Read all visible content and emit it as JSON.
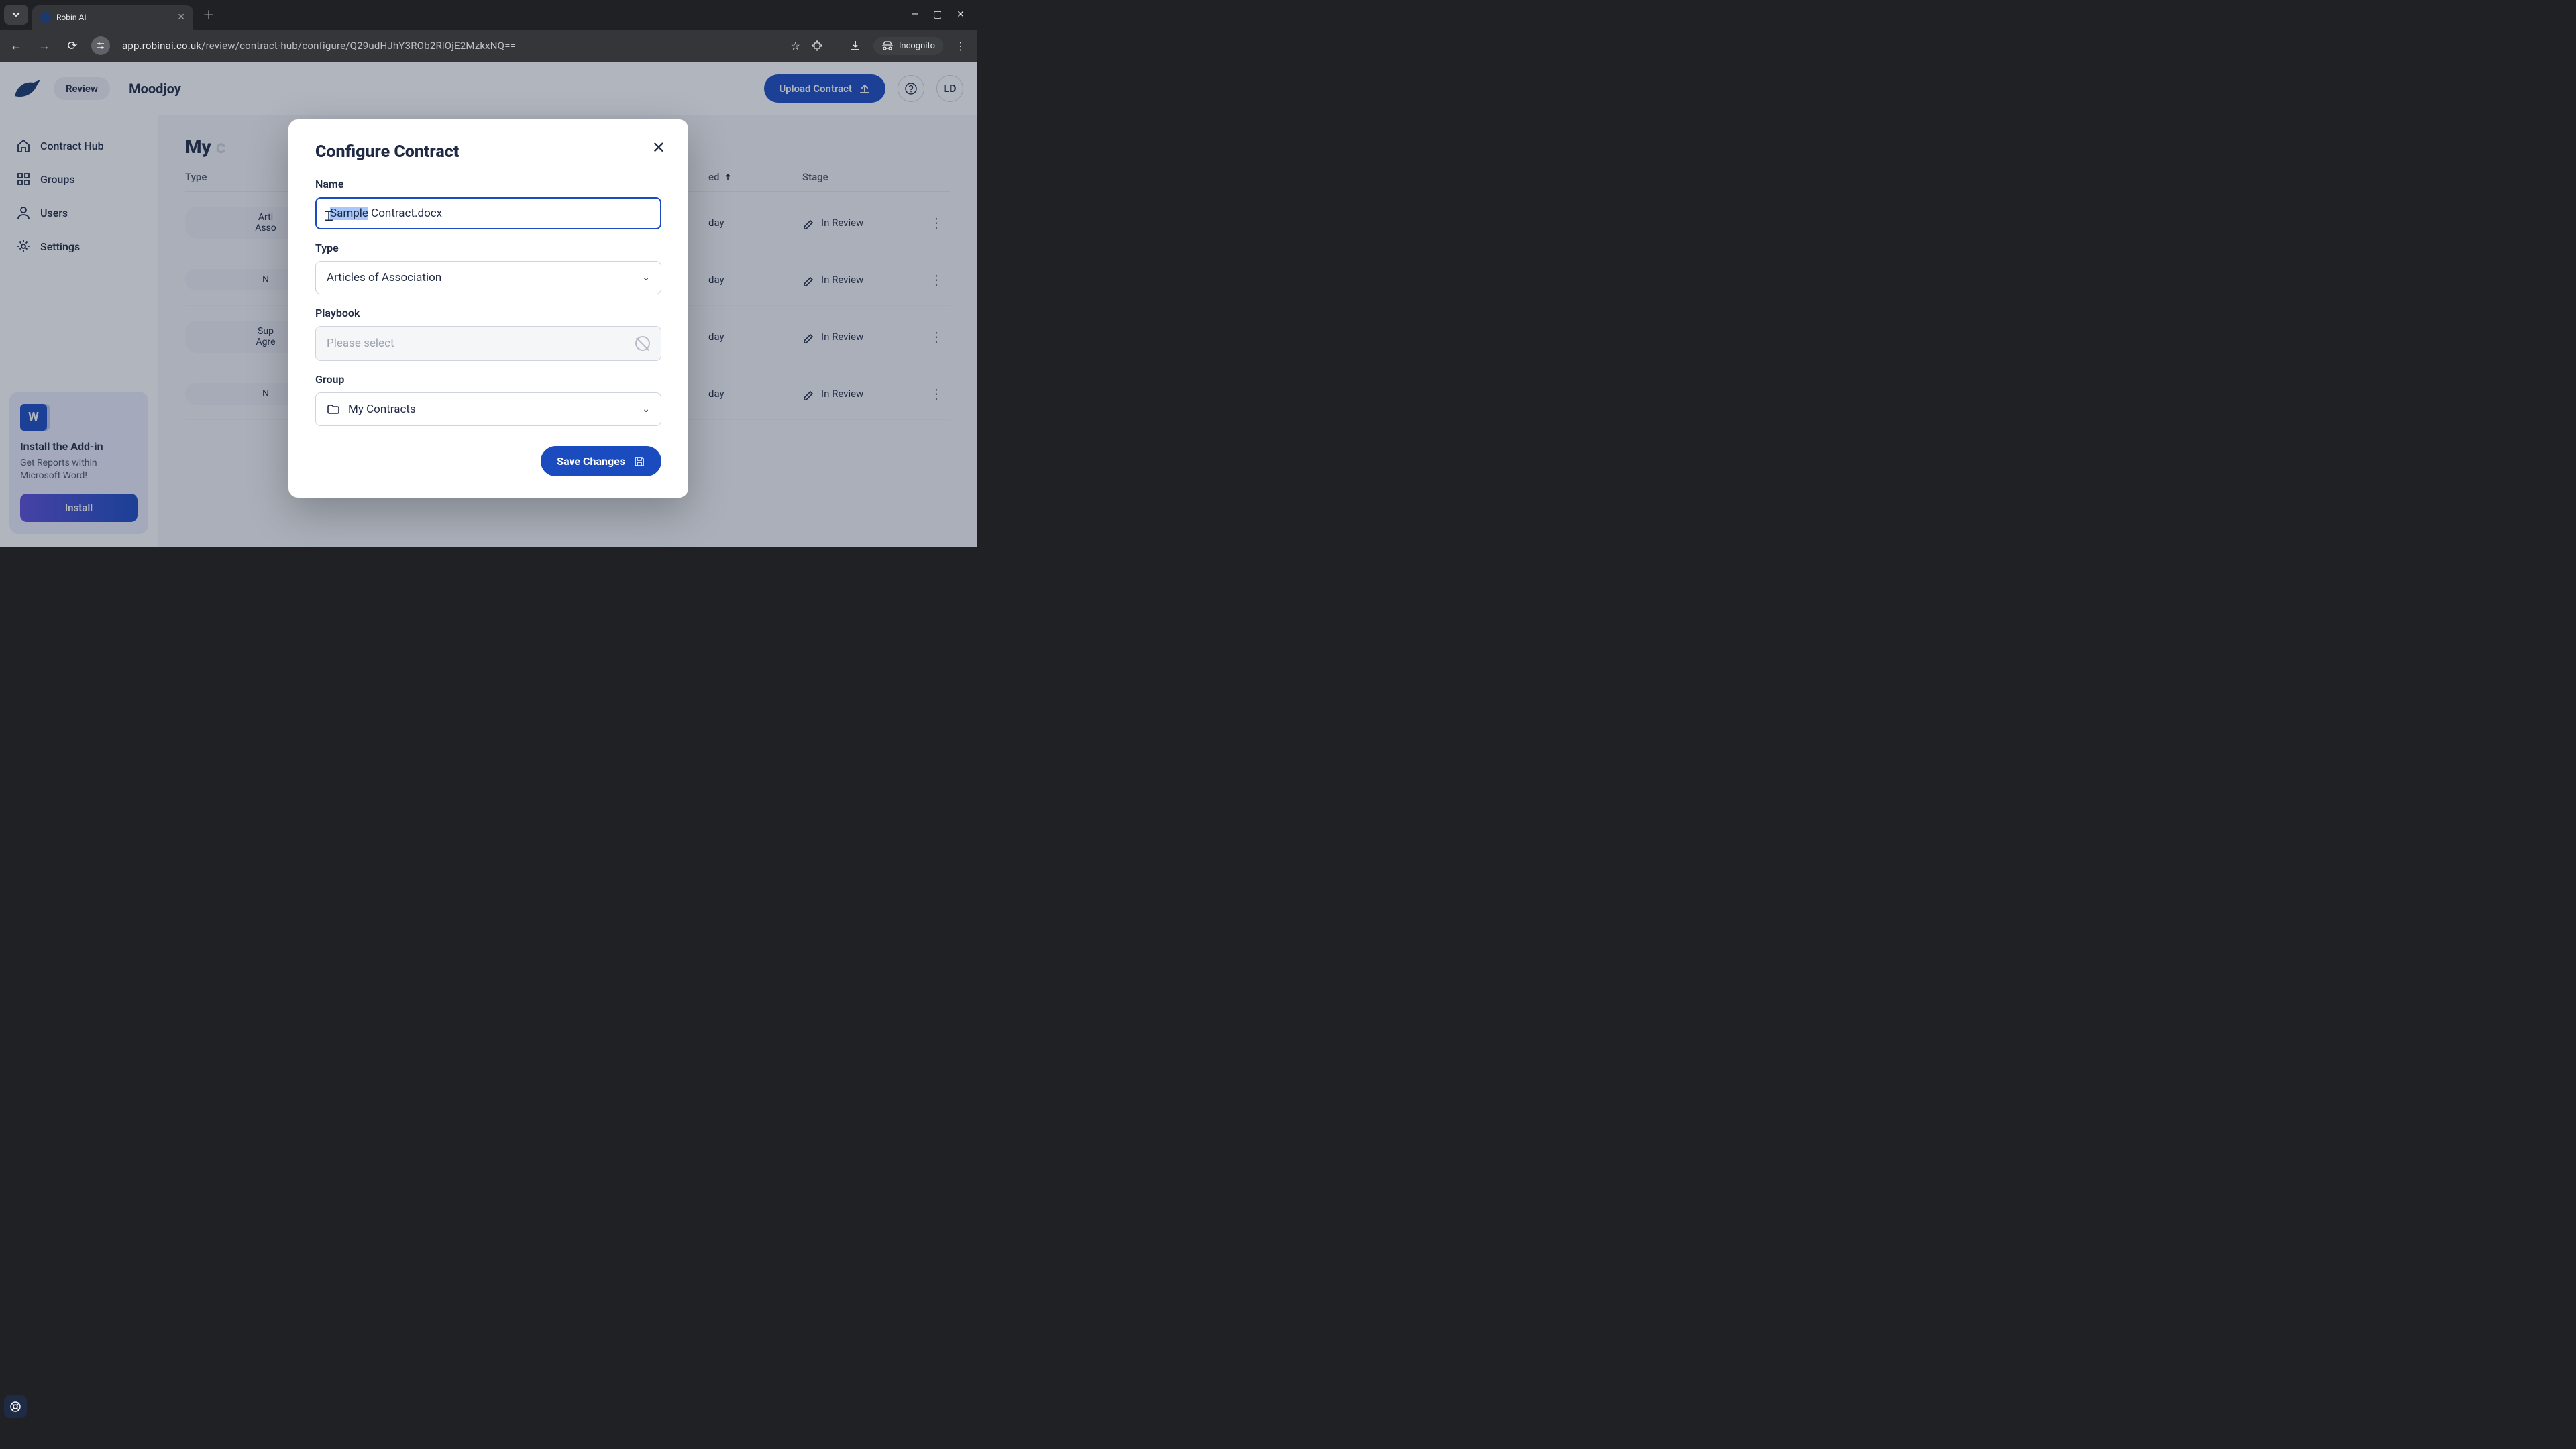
{
  "browser": {
    "tab_title": "Robin AI",
    "url_domain": "app.robinai.co.uk",
    "url_path": "/review/contract-hub/configure/Q29udHJhY3ROb2RlOjE2MzkxNQ==",
    "incognito_label": "Incognito"
  },
  "header": {
    "review_label": "Review",
    "workspace": "Moodjoy",
    "upload_label": "Upload Contract",
    "avatar_initials": "LD"
  },
  "sidebar": {
    "items": [
      {
        "label": "Contract Hub"
      },
      {
        "label": "Groups"
      },
      {
        "label": "Users"
      },
      {
        "label": "Settings"
      }
    ],
    "addin": {
      "title": "Install the Add-in",
      "subtitle": "Get Reports within Microsoft Word!",
      "button": "Install"
    }
  },
  "main": {
    "title_prefix": "My",
    "columns": {
      "type": "Type",
      "created": "ed",
      "stage": "Stage"
    },
    "rows": [
      {
        "type_line1": "Arti",
        "type_line2": "Asso",
        "created": "day",
        "stage": "In Review"
      },
      {
        "type_line1": "N",
        "type_line2": "",
        "created": "day",
        "stage": "In Review"
      },
      {
        "type_line1": "Sup",
        "type_line2": "Agre",
        "created": "day",
        "stage": "In Review"
      },
      {
        "type_line1": "N",
        "type_line2": "",
        "created": "day",
        "stage": "In Review"
      }
    ]
  },
  "modal": {
    "title": "Configure Contract",
    "name_label": "Name",
    "name_selected": "Sample",
    "name_rest": " Contract.docx",
    "type_label": "Type",
    "type_value": "Articles of Association",
    "playbook_label": "Playbook",
    "playbook_placeholder": "Please select",
    "group_label": "Group",
    "group_value": "My Contracts",
    "save_label": "Save Changes"
  }
}
